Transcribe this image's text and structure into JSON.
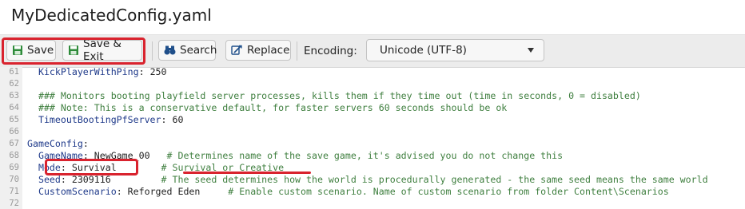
{
  "window": {
    "title": "MyDedicatedConfig.yaml"
  },
  "toolbar": {
    "save_label": "Save",
    "save_exit_label": "Save & Exit",
    "search_label": "Search",
    "replace_label": "Replace",
    "encoding_label": "Encoding:",
    "encoding_value": "Unicode (UTF-8)"
  },
  "editor": {
    "lines": [
      {
        "num": "61",
        "parts": [
          [
            "k",
            "  KickPlayerWithPing"
          ],
          [
            "t",
            ": 250"
          ]
        ]
      },
      {
        "num": "62",
        "parts": []
      },
      {
        "num": "63",
        "parts": [
          [
            "c",
            "  ### Monitors booting playfield server processes, kills them if they time out (time in seconds, 0 = disabled)"
          ]
        ]
      },
      {
        "num": "64",
        "parts": [
          [
            "c",
            "  ### Note: This is a conservative default, for faster servers 60 seconds should be ok"
          ]
        ]
      },
      {
        "num": "65",
        "parts": [
          [
            "k",
            "  TimeoutBootingPfServer"
          ],
          [
            "t",
            ": 60"
          ]
        ]
      },
      {
        "num": "66",
        "parts": []
      },
      {
        "num": "67",
        "parts": [
          [
            "k",
            "GameConfig"
          ],
          [
            "t",
            ":"
          ]
        ]
      },
      {
        "num": "68",
        "parts": [
          [
            "k",
            "  GameName"
          ],
          [
            "t",
            ": NewGame_00   "
          ],
          [
            "c",
            "# Determines name of the save game, it's advised you do not change this"
          ]
        ]
      },
      {
        "num": "69",
        "parts": [
          [
            "k",
            "  Mode"
          ],
          [
            "t",
            ": Survival        "
          ],
          [
            "c",
            "# Survival or Creative"
          ]
        ]
      },
      {
        "num": "70",
        "parts": [
          [
            "k",
            "  Seed"
          ],
          [
            "t",
            ": 2309116         "
          ],
          [
            "c",
            "# The seed determines how the world is procedurally generated - the same seed means the same world"
          ]
        ]
      },
      {
        "num": "71",
        "parts": [
          [
            "k",
            "  CustomScenario"
          ],
          [
            "t",
            ": Reforged Eden     "
          ],
          [
            "c",
            "# Enable custom scenario. Name of custom scenario from folder Content\\Scenarios"
          ]
        ]
      },
      {
        "num": "72",
        "parts": []
      }
    ]
  },
  "colors": {
    "highlight": "#d9232e",
    "keyword": "#1f3a8a",
    "comment": "#3f7f3f"
  }
}
